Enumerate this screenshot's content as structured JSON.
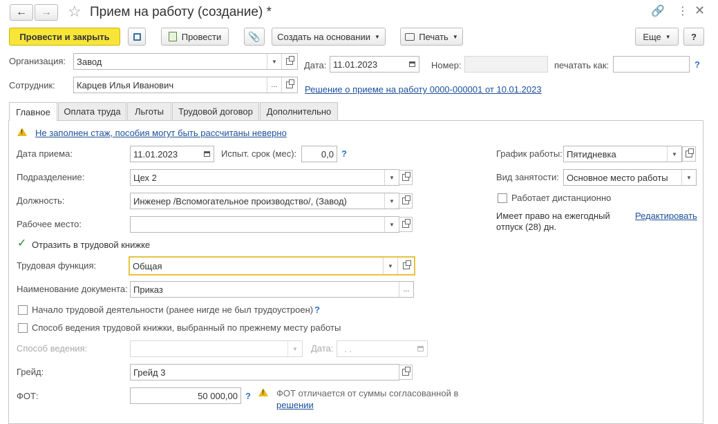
{
  "window": {
    "title": "Прием на работу (создание) *"
  },
  "toolbar": {
    "post_and_close": "Провести и закрыть",
    "post": "Провести",
    "create_based_on": "Создать на основании",
    "print": "Печать",
    "more": "Еще",
    "help": "?"
  },
  "header": {
    "organization_label": "Организация:",
    "organization_value": "Завод",
    "date_label": "Дата:",
    "date_value": "11.01.2023",
    "number_label": "Номер:",
    "number_value": "",
    "print_as_label": "печатать как:",
    "print_as_value": "",
    "help_mark": "?",
    "employee_label": "Сотрудник:",
    "employee_value": "Карцев Илья Иванович",
    "decision_link": "Решение о приеме на работу 0000-000001 от 10.01.2023"
  },
  "tabs": [
    {
      "label": "Главное",
      "active": true
    },
    {
      "label": "Оплата труда",
      "active": false
    },
    {
      "label": "Льготы",
      "active": false
    },
    {
      "label": "Трудовой договор",
      "active": false
    },
    {
      "label": "Дополнительно",
      "active": false
    }
  ],
  "main": {
    "warning_text": "Не заполнен стаж, пособия могут быть рассчитаны неверно",
    "hire_date_label": "Дата приема:",
    "hire_date_value": "11.01.2023",
    "probation_label": "Испыт. срок (мес):",
    "probation_value": "0,0",
    "department_label": "Подразделение:",
    "department_value": "Цех 2",
    "position_label": "Должность:",
    "position_value": "Инженер /Вспомогательное производство/, (Завод)",
    "workplace_label": "Рабочее место:",
    "workplace_value": "",
    "reflect_in_book_label": "Отразить в трудовой книжке",
    "reflect_in_book_checked": true,
    "labor_function_label": "Трудовая функция:",
    "labor_function_value": "Общая",
    "doc_name_label": "Наименование документа:",
    "doc_name_value": "Приказ",
    "career_start_label": "Начало трудовой деятельности (ранее нигде не был трудоустроен)",
    "career_start_checked": false,
    "book_method_prev_label": "Способ ведения трудовой книжки, выбранный по прежнему месту работы",
    "book_method_prev_checked": false,
    "method_label": "Способ ведения:",
    "method_value": "",
    "method_date_label": "Дата:",
    "method_date_value": " .  .",
    "grade_label": "Грейд:",
    "grade_value": "Грейд 3",
    "fot_label": "ФОТ:",
    "fot_value": "50 000,00",
    "fot_warning_line1": "ФОТ отличается от суммы согласованной в",
    "fot_warning_link": "решении",
    "schedule_label": "График работы:",
    "schedule_value": "Пятидневка",
    "employment_type_label": "Вид занятости:",
    "employment_type_value": "Основное место работы",
    "remote_label": "Работает дистанционно",
    "remote_checked": false,
    "vacation_line1": "Имеет право на ежегодный",
    "vacation_line2": "отпуск (28) дн.",
    "edit_link": "Редактировать"
  },
  "colors": {
    "primary_button": "#f8e53a",
    "link": "#1c4f9b",
    "help": "#2a72c7",
    "warning": "#e8b81a",
    "focus_border": "#e8c33d"
  }
}
